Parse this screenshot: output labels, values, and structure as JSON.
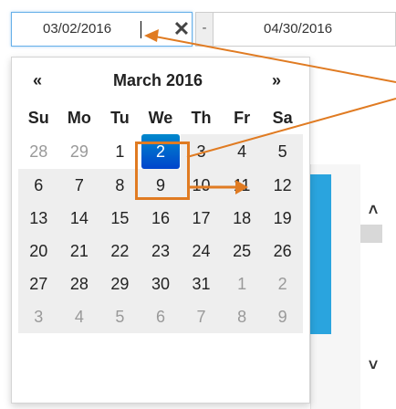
{
  "range": {
    "start_value": "03/02/2016",
    "clear_symbol": "✕",
    "separator": "-",
    "end_value": "04/30/2016"
  },
  "calendar": {
    "prev_label": "«",
    "next_label": "»",
    "title": "March 2016",
    "weekdays": [
      "Su",
      "Mo",
      "Tu",
      "We",
      "Th",
      "Fr",
      "Sa"
    ],
    "weeks": [
      [
        "28",
        "29",
        "1",
        "2",
        "3",
        "4",
        "5"
      ],
      [
        "6",
        "7",
        "8",
        "9",
        "10",
        "11",
        "12"
      ],
      [
        "13",
        "14",
        "15",
        "16",
        "17",
        "18",
        "19"
      ],
      [
        "20",
        "21",
        "22",
        "23",
        "24",
        "25",
        "26"
      ],
      [
        "27",
        "28",
        "29",
        "30",
        "31",
        "1",
        "2"
      ],
      [
        "3",
        "4",
        "5",
        "6",
        "7",
        "8",
        "9"
      ]
    ],
    "selected": "2"
  },
  "scroll": {
    "up_icon": "chevron-up-icon",
    "down_icon": "chevron-down-icon"
  },
  "colors": {
    "selected_day": "#0062c4",
    "annotation": "#e07b22",
    "side_bar": "#2aa4de",
    "input_focus": "#66afe9"
  }
}
